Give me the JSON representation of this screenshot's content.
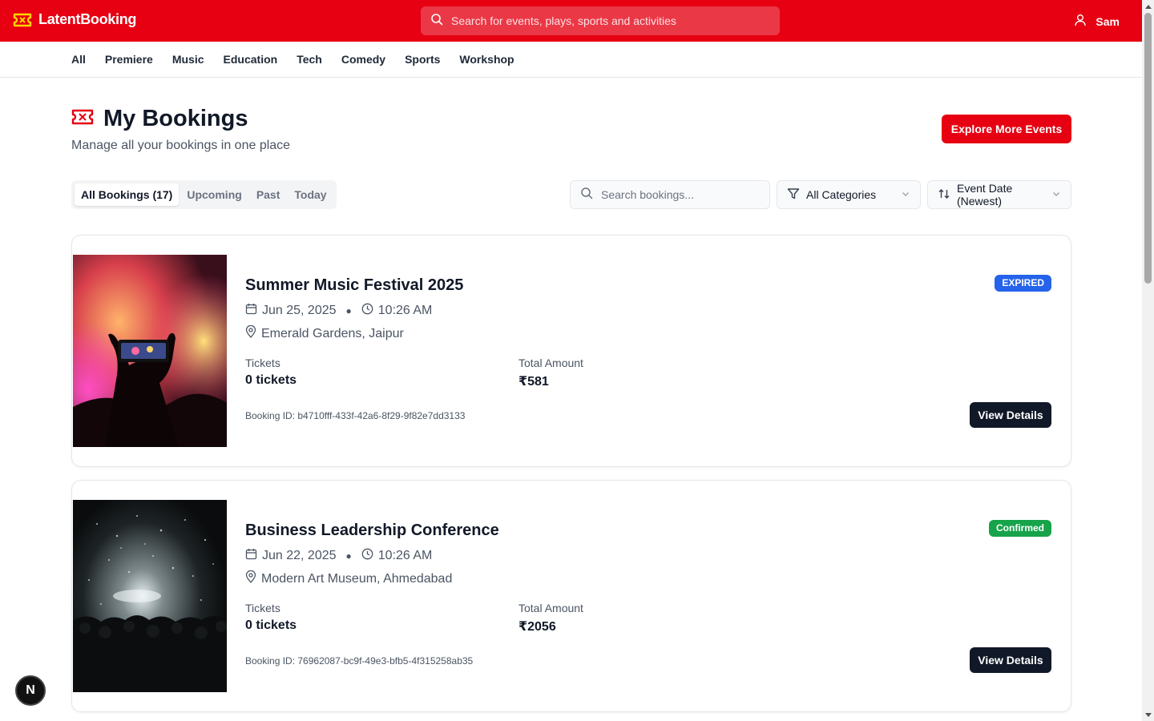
{
  "brand": {
    "name": "LatentBooking",
    "color": "#e60012"
  },
  "top_search": {
    "placeholder": "Search for events, plays, sports and activities"
  },
  "user": {
    "name": "Sam"
  },
  "categories": [
    "All",
    "Premiere",
    "Music",
    "Education",
    "Tech",
    "Comedy",
    "Sports",
    "Workshop"
  ],
  "page": {
    "title": "My Bookings",
    "subtitle": "Manage all your bookings in one place",
    "explore_label": "Explore More Events"
  },
  "tabs": [
    "All Bookings (17)",
    "Upcoming",
    "Past",
    "Today"
  ],
  "booking_search": {
    "placeholder": "Search bookings..."
  },
  "filters": {
    "category": "All Categories",
    "sort": "Event Date (Newest)"
  },
  "bookings": [
    {
      "title": "Summer Music Festival 2025",
      "date": "Jun 25, 2025",
      "time": "10:26 AM",
      "location": "Emerald Gardens, Jaipur",
      "tickets_label": "Tickets",
      "tickets": "0 tickets",
      "amount_label": "Total Amount",
      "amount": "₹581",
      "booking_id": "Booking ID: b4710fff-433f-42a6-8f29-9f82e7dd3133",
      "status": "EXPIRED",
      "status_color": "#2563eb",
      "action": "View Details"
    },
    {
      "title": "Business Leadership Conference",
      "date": "Jun 22, 2025",
      "time": "10:26 AM",
      "location": "Modern Art Museum, Ahmedabad",
      "tickets_label": "Tickets",
      "tickets": "0 tickets",
      "amount_label": "Total Amount",
      "amount": "₹2056",
      "booking_id": "Booking ID: 76962087-bc9f-49e3-bfb5-4f315258ab35",
      "status": "Confirmed",
      "status_color": "#16a34a",
      "action": "View Details"
    }
  ],
  "dev_badge": {
    "letter": "N"
  }
}
